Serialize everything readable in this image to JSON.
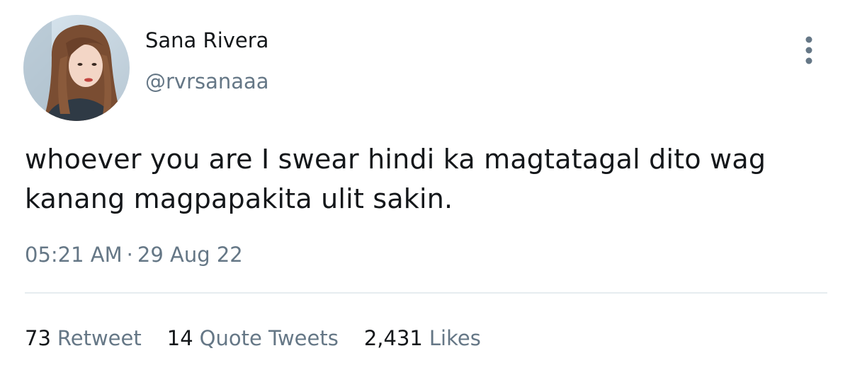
{
  "tweet": {
    "author": {
      "display_name": "Sana Rivera",
      "handle": "@rvrsanaaa"
    },
    "text": "whoever you are I swear hindi ka magtatagal dito wag kanang magpapakita ulit sakin.",
    "time": "05:21 AM",
    "separator": "·",
    "date": "29 Aug 22",
    "stats": {
      "retweets_count": "73",
      "retweets_label": "Retweet",
      "quotes_count": "14",
      "quotes_label": "Quote Tweets",
      "likes_count": "2,431",
      "likes_label": "Likes"
    }
  },
  "icons": {
    "more": "more-vertical-icon"
  },
  "colors": {
    "text_primary": "#14171a",
    "text_secondary": "#657786",
    "divider": "#e6ecf0",
    "background": "#ffffff"
  }
}
